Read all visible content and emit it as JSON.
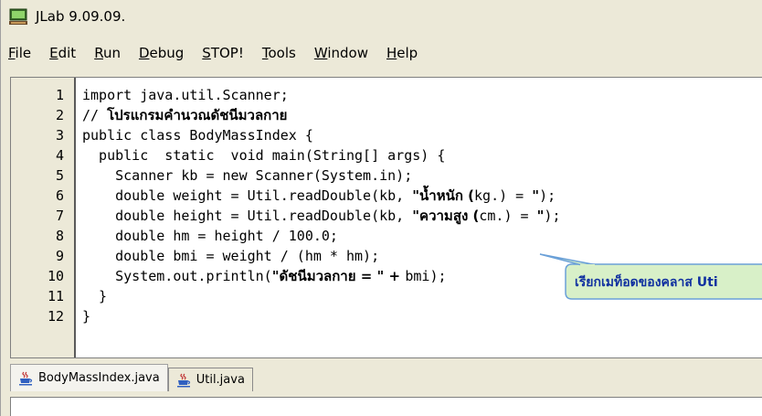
{
  "window": {
    "title": "JLab 9.09.09."
  },
  "menu": [
    {
      "mn": "F",
      "rest": "ile"
    },
    {
      "mn": "E",
      "rest": "dit"
    },
    {
      "mn": "R",
      "rest": "un"
    },
    {
      "mn": "D",
      "rest": "ebug"
    },
    {
      "mn": "S",
      "rest": "TOP!"
    },
    {
      "mn": "T",
      "rest": "ools"
    },
    {
      "mn": "W",
      "rest": "indow"
    },
    {
      "mn": "H",
      "rest": "elp"
    }
  ],
  "editor": {
    "line_numbers": [
      "1",
      "2",
      "3",
      "4",
      "5",
      "6",
      "7",
      "8",
      "9",
      "10",
      "11",
      "12"
    ],
    "lines": [
      {
        "plain": "import java.util.Scanner;"
      },
      {
        "plain": "// ",
        "bold": "โปรแกรมคำนวณดัชนีมวลกาย"
      },
      {
        "plain": "public class BodyMassIndex {"
      },
      {
        "plain": "  public  static  void main(String[] args) {"
      },
      {
        "plain": "    Scanner kb = new Scanner(System.in);"
      },
      {
        "plain": "    double weight = Util.readDouble(kb, ",
        "bold": "\"น้ำหนัก (",
        "plain2": "kg.) = ",
        "bold2": "\"",
        "plain3": ");"
      },
      {
        "plain": "    double height = Util.readDouble(kb, ",
        "bold": "\"ความสูง (",
        "plain2": "cm.) = ",
        "bold2": "\"",
        "plain3": ");"
      },
      {
        "plain": "    double hm = height / 100.0;"
      },
      {
        "plain": "    double bmi = weight / (hm * hm);"
      },
      {
        "plain": "    System.out.println(",
        "bold": "\"ดัชนีมวลกาย = \" + ",
        "plain2": "bmi);"
      },
      {
        "plain": "  }"
      },
      {
        "plain": "}"
      }
    ]
  },
  "callout": {
    "text": "เรียกเมท็อดของคลาส Uti"
  },
  "tabs": [
    {
      "label": "BodyMassIndex.java",
      "active": true
    },
    {
      "label": "Util.java",
      "active": false
    }
  ]
}
